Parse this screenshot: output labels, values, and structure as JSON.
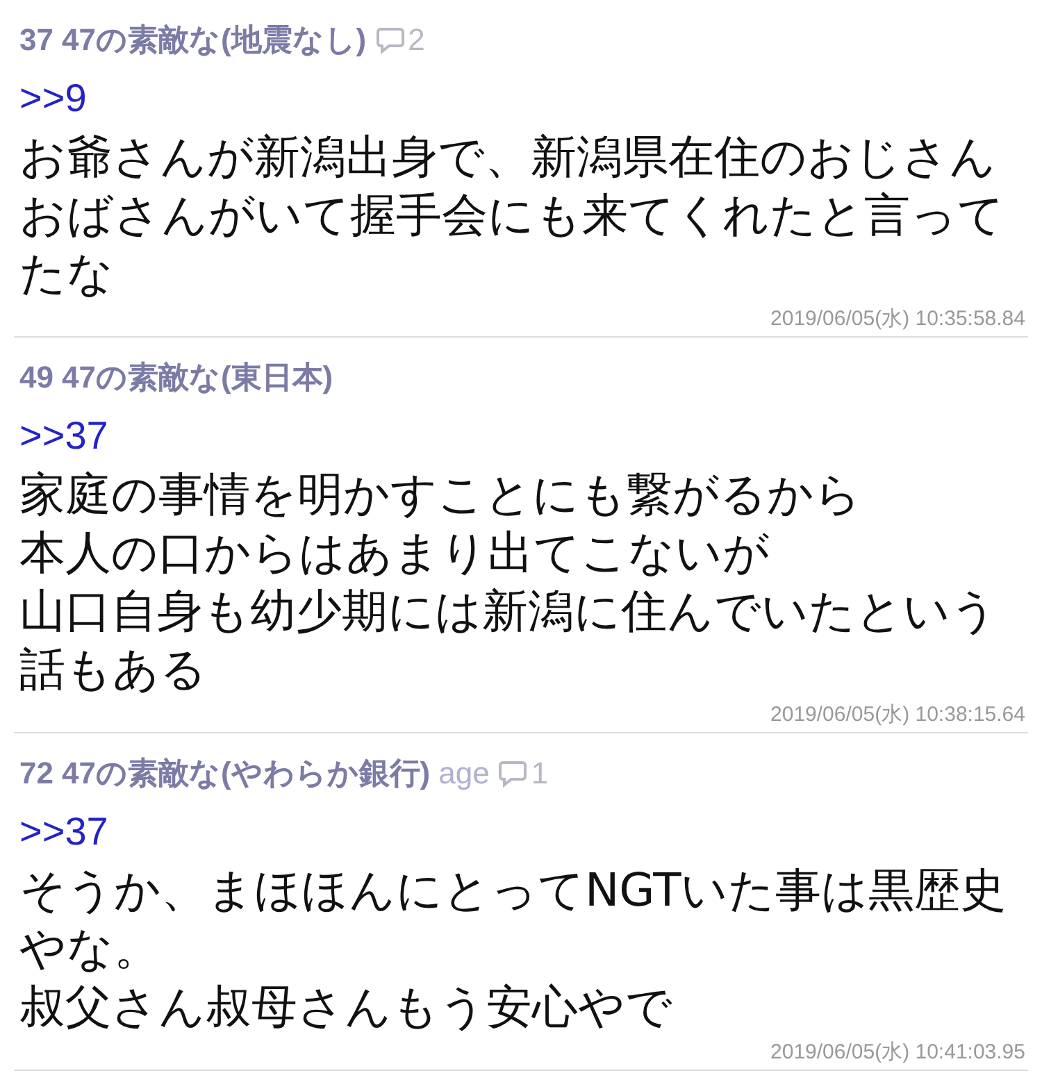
{
  "posts": [
    {
      "number": "37",
      "name": "47の素敵な(地震なし)",
      "replies": "2",
      "anchor": ">>9",
      "paragraphs": [
        "お爺さんが新潟出身で、新潟県在住のおじさんおばさんがいて握手会にも来てくれたと言ってたな"
      ],
      "date": "2019/06/05(水) 10:35:58.84"
    },
    {
      "number": "49",
      "name": "47の素敵な(東日本)",
      "anchor": ">>37",
      "paragraphs": [
        "家庭の事情を明かすことにも繋がるから",
        "本人の口からはあまり出てこないが",
        "山口自身も幼少期には新潟に住んでいたという話もある"
      ],
      "date": "2019/06/05(水) 10:38:15.64"
    },
    {
      "number": "72",
      "name": "47の素敵な(やわらか銀行)",
      "mail": "age",
      "replies": "1",
      "anchor": ">>37",
      "paragraphs": [
        "そうか、まほほんにとってNGTいた事は黒歴史やな。",
        "叔父さん叔母さんもう安心やで"
      ],
      "date": "2019/06/05(水) 10:41:03.95"
    }
  ]
}
